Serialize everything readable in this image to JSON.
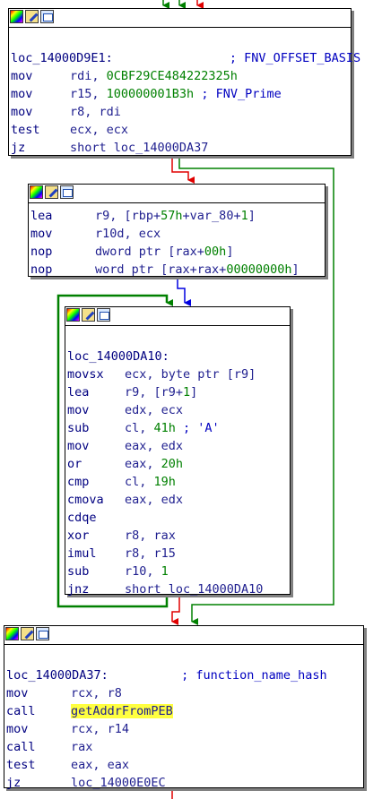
{
  "blocks": [
    {
      "name": "block-loc-14000d9e1",
      "lines": [
        {
          "type": "blank"
        },
        {
          "type": "label",
          "text": "loc_14000D9E1:",
          "comment": "; FNV_OFFSET_BASIS"
        },
        {
          "type": "instr",
          "mnemonic": "mov",
          "ops": [
            {
              "t": "rdi, "
            },
            {
              "t": "0CBF29CE484222325h",
              "c": "num"
            }
          ]
        },
        {
          "type": "instr",
          "mnemonic": "mov",
          "ops": [
            {
              "t": "r15, "
            },
            {
              "t": "100000001B3h",
              "c": "num"
            },
            {
              "t": " ; FNV_Prime",
              "c": "cmt"
            }
          ]
        },
        {
          "type": "instr",
          "mnemonic": "mov",
          "ops": [
            {
              "t": "r8, rdi"
            }
          ]
        },
        {
          "type": "instr",
          "mnemonic": "test",
          "ops": [
            {
              "t": "ecx, ecx"
            }
          ]
        },
        {
          "type": "instr",
          "mnemonic": "jz",
          "ops": [
            {
              "t": "short loc_14000DA37"
            }
          ]
        }
      ]
    },
    {
      "name": "block-lea-r9",
      "lines": [
        {
          "type": "instr",
          "mnemonic": "lea",
          "ops": [
            {
              "t": "r9, [rbp+"
            },
            {
              "t": "57h",
              "c": "num"
            },
            {
              "t": "+var_80+"
            },
            {
              "t": "1",
              "c": "num"
            },
            {
              "t": "]"
            }
          ]
        },
        {
          "type": "instr",
          "mnemonic": "mov",
          "ops": [
            {
              "t": "r10d, ecx"
            }
          ]
        },
        {
          "type": "instr",
          "mnemonic": "nop",
          "ops": [
            {
              "t": "dword ptr [rax+"
            },
            {
              "t": "00h",
              "c": "num"
            },
            {
              "t": "]"
            }
          ]
        },
        {
          "type": "instr",
          "mnemonic": "nop",
          "ops": [
            {
              "t": "word ptr [rax+rax+"
            },
            {
              "t": "00000000h",
              "c": "num"
            },
            {
              "t": "]"
            }
          ]
        }
      ]
    },
    {
      "name": "block-loc-14000da10",
      "lines": [
        {
          "type": "blank"
        },
        {
          "type": "label",
          "text": "loc_14000DA10:",
          "comment": ""
        },
        {
          "type": "instr",
          "mnemonic": "movsx",
          "ops": [
            {
              "t": "ecx, byte ptr [r9]"
            }
          ]
        },
        {
          "type": "instr",
          "mnemonic": "lea",
          "ops": [
            {
              "t": "r9, [r9+"
            },
            {
              "t": "1",
              "c": "num"
            },
            {
              "t": "]"
            }
          ]
        },
        {
          "type": "instr",
          "mnemonic": "mov",
          "ops": [
            {
              "t": "edx, ecx"
            }
          ]
        },
        {
          "type": "instr",
          "mnemonic": "sub",
          "ops": [
            {
              "t": "cl, "
            },
            {
              "t": "41h",
              "c": "num"
            },
            {
              "t": " ; 'A'",
              "c": "cmt"
            }
          ]
        },
        {
          "type": "instr",
          "mnemonic": "mov",
          "ops": [
            {
              "t": "eax, edx"
            }
          ]
        },
        {
          "type": "instr",
          "mnemonic": "or",
          "ops": [
            {
              "t": "eax, "
            },
            {
              "t": "20h",
              "c": "num"
            }
          ]
        },
        {
          "type": "instr",
          "mnemonic": "cmp",
          "ops": [
            {
              "t": "cl, "
            },
            {
              "t": "19h",
              "c": "num"
            }
          ]
        },
        {
          "type": "instr",
          "mnemonic": "cmova",
          "ops": [
            {
              "t": "eax, edx"
            }
          ]
        },
        {
          "type": "instr",
          "mnemonic": "cdqe",
          "ops": []
        },
        {
          "type": "instr",
          "mnemonic": "xor",
          "ops": [
            {
              "t": "r8, rax"
            }
          ]
        },
        {
          "type": "instr",
          "mnemonic": "imul",
          "ops": [
            {
              "t": "r8, r15"
            }
          ]
        },
        {
          "type": "instr",
          "mnemonic": "sub",
          "ops": [
            {
              "t": "r10, "
            },
            {
              "t": "1",
              "c": "num"
            }
          ]
        },
        {
          "type": "instr",
          "mnemonic": "jnz",
          "ops": [
            {
              "t": "short loc_14000DA10"
            }
          ]
        }
      ]
    },
    {
      "name": "block-loc-14000da37",
      "lines": [
        {
          "type": "blank"
        },
        {
          "type": "label",
          "text": "loc_14000DA37:",
          "comment": "; function_name_hash"
        },
        {
          "type": "instr",
          "mnemonic": "mov",
          "ops": [
            {
              "t": "rcx, r8"
            }
          ]
        },
        {
          "type": "instr",
          "mnemonic": "call",
          "ops": [
            {
              "t": "getAddrFromPEB",
              "c": "hl"
            }
          ]
        },
        {
          "type": "instr",
          "mnemonic": "mov",
          "ops": [
            {
              "t": "rcx, r14"
            }
          ]
        },
        {
          "type": "instr",
          "mnemonic": "call",
          "ops": [
            {
              "t": "rax"
            }
          ]
        },
        {
          "type": "instr",
          "mnemonic": "test",
          "ops": [
            {
              "t": "eax, eax"
            }
          ]
        },
        {
          "type": "instr",
          "mnemonic": "jz",
          "ops": [
            {
              "t": "loc_14000E0EC"
            }
          ]
        }
      ]
    }
  ],
  "edge_colors": {
    "taken": "#008000",
    "not_taken": "#e00000",
    "unconditional": "#0000e0"
  },
  "icons": [
    "color-palette-icon",
    "edit-block-icon",
    "graph-view-icon"
  ]
}
